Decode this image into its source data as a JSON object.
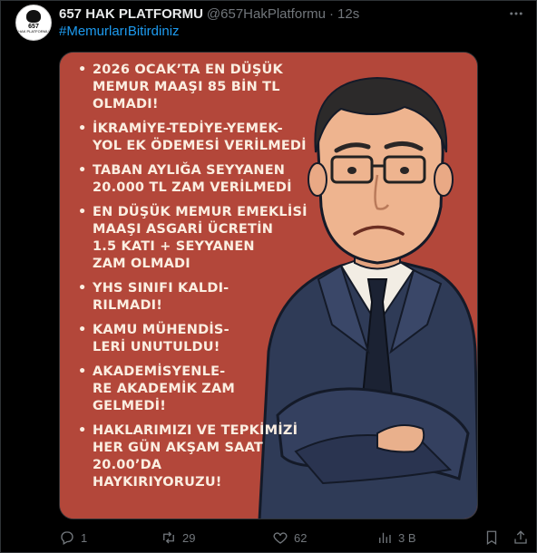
{
  "author": {
    "display_name": "657 HAK PLATFORMU",
    "handle": "@657HakPlatformu",
    "separator": "·",
    "timestamp": "12s",
    "avatar_text": "657",
    "avatar_subtext": "HAK PLATFORMU"
  },
  "tweet": {
    "hashtag": "#MemurlarıBitirdiniz"
  },
  "poster": {
    "items": [
      [
        "2026 OCAK’TA EN DÜŞÜK",
        "MEMUR MAAŞI 85 BİN TL",
        "OLMADI!"
      ],
      [
        "İKRAMİYE-TEDİYE-YEMEK-",
        "YOL EK ÖDEMESİ VERİLMEDİ"
      ],
      [
        "TABAN AYLIĞA SEYYANEN",
        "20.000 TL ZAM VERİLMEDİ"
      ],
      [
        "EN DÜŞÜK MEMUR EMEKLİSİ",
        "MAAŞI ASGARİ ÜCRETİN",
        "1.5 KATI + SEYYANEN",
        "ZAM OLMADI"
      ],
      [
        "YHS SINIFI KALDI-",
        "RILMADI!"
      ],
      [
        "KAMU MÜHENDİS-",
        "LERİ UNUTULDU!"
      ],
      [
        "AKADEMİSYENLE-",
        "RE AKADEMİK ZAM",
        "GELMEDİ!"
      ],
      [
        "HAKLARIMIZI VE TEPKİMİZİ",
        "HER GÜN AKŞAM SAAT 20.00’DA",
        "HAYKIRIYORUZU!"
      ]
    ],
    "background_color": "#b3473a",
    "text_color": "#fbeee1"
  },
  "actions": {
    "reply_count": "1",
    "retweet_count": "29",
    "like_count": "62",
    "views_count": "3 B"
  },
  "icons": {
    "more": "more-icon",
    "reply": "reply-icon",
    "retweet": "retweet-icon",
    "like": "heart-icon",
    "views": "views-icon",
    "bookmark": "bookmark-icon",
    "share": "share-icon"
  },
  "colors": {
    "background": "#000000",
    "text": "#e7e9ea",
    "muted": "#71767b",
    "link": "#1d9bf0"
  }
}
